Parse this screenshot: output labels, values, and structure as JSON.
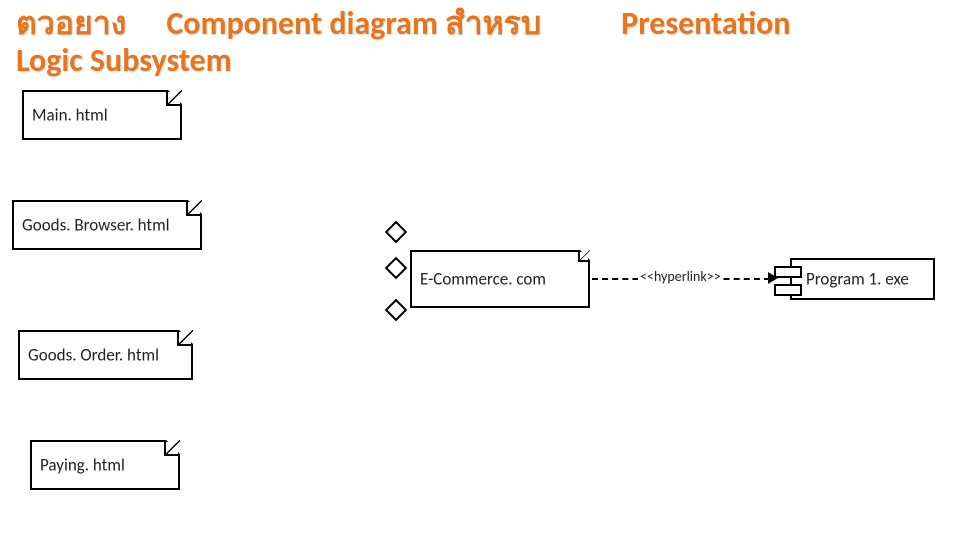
{
  "title": {
    "part1": "ตวอยาง",
    "part2": "Component diagram สำหรบ",
    "part3": "Presentation",
    "part4": "Logic Subsystem"
  },
  "files": {
    "main": {
      "label": "Main. html"
    },
    "goodsBrowser": {
      "label": "Goods. Browser. html"
    },
    "goodsOrder": {
      "label": "Goods. Order. html"
    },
    "paying": {
      "label": "Paying. html"
    },
    "ecommerce": {
      "label": "E-Commerce. com"
    }
  },
  "components": {
    "program1": {
      "label": "Program 1. exe"
    }
  },
  "link": {
    "stereotype": "<<hyperlink>>"
  }
}
